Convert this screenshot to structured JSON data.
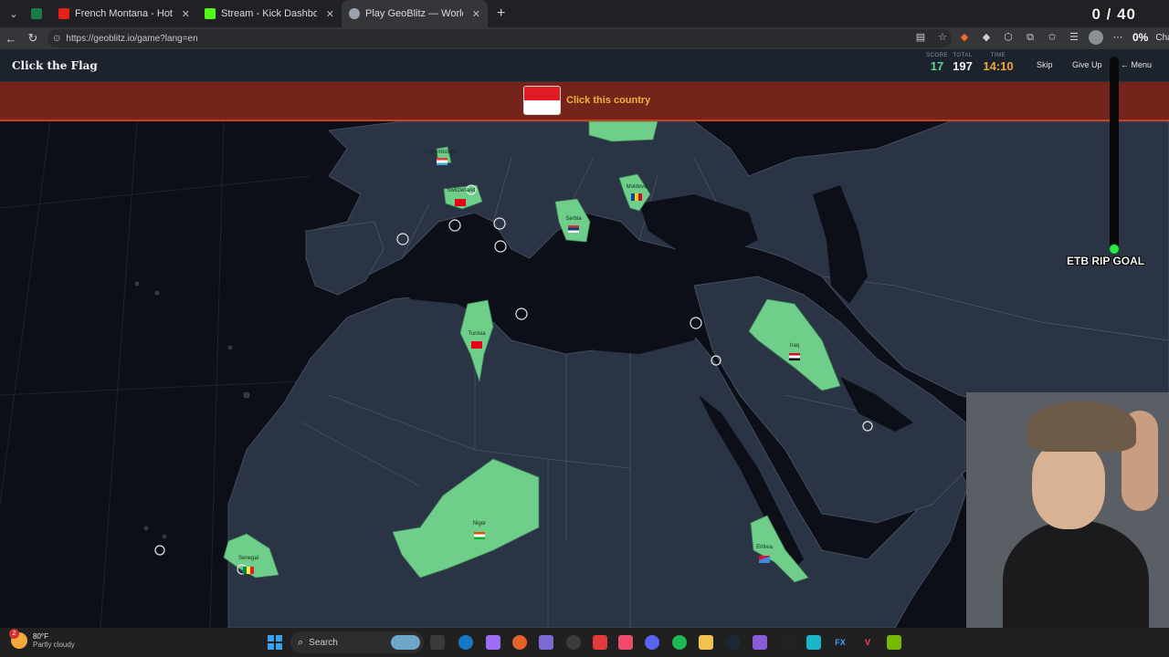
{
  "browser": {
    "tabs": [
      {
        "title": "",
        "favicon_color": "#1b7a45"
      },
      {
        "title": "French Montana - Hot Boy Bling ft",
        "favicon_color": "#e62117"
      },
      {
        "title": "Stream - Kick Dashboard",
        "favicon_color": "#53fc18"
      },
      {
        "title": "Play GeoBlitz — World Geography",
        "favicon_color": "#9aa3ad",
        "active": true
      }
    ],
    "url": "https://geoblitz.io/game?lang=en",
    "extension_percent": "0%",
    "chat_label": "Chat"
  },
  "stream_overlay": {
    "counter": "0 / 40",
    "goal_label": "ETB RIP GOAL"
  },
  "game": {
    "title": "Click the Flag",
    "stats": {
      "score_label": "SCORE",
      "score": "17",
      "total_label": "TOTAL",
      "total": "197",
      "time_label": "TIME",
      "time": "14:10"
    },
    "buttons": {
      "skip": "Skip",
      "give_up": "Give Up",
      "menu": "← Menu"
    },
    "prompt": "Click this country",
    "prompt_flag_colors": [
      "#e01b24",
      "#ffffff"
    ]
  },
  "map": {
    "labels": {
      "luxembourg": "Luxembourg",
      "switzerland": "Switzerland",
      "moldova": "Moldova",
      "serbia": "Serbia",
      "tunisia": "Tunisia",
      "iraq": "Iraq",
      "niger": "Niger",
      "senegal": "Senegal",
      "eritrea": "Eritrea"
    },
    "colors": {
      "ocean": "#0c0f17",
      "land": "#2b3445",
      "border": "#4c5668",
      "found": "#6fcf8a",
      "target_marker": "#ffffff"
    }
  },
  "taskbar": {
    "weather_temp": "80°F",
    "weather_condition": "Partly cloudy",
    "notification_count": "2",
    "search_placeholder": "Search",
    "apps": [
      "file-explorer",
      "edge",
      "copilot",
      "firefox",
      "teams",
      "obs",
      "scrcpy",
      "music",
      "discord",
      "spotify",
      "folder",
      "steam",
      "clapper",
      "proton",
      "vpn",
      "fx",
      "valorant",
      "nvidia"
    ]
  }
}
